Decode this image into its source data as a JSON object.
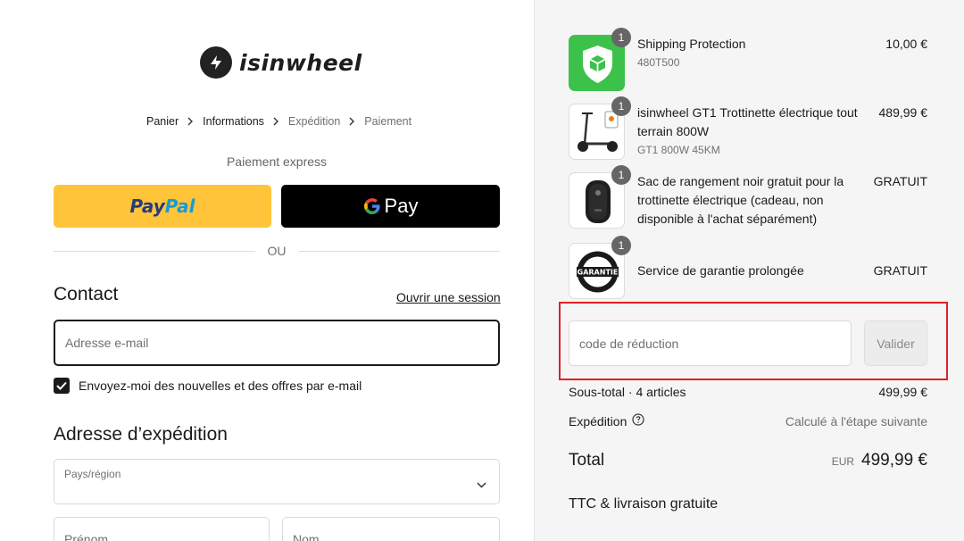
{
  "brand": {
    "name": "isinwheel"
  },
  "breadcrumb": [
    "Panier",
    "Informations",
    "Expédition",
    "Paiement"
  ],
  "express": {
    "label": "Paiement express",
    "paypal_pay": "Pay",
    "paypal_pal": "Pal",
    "gpay_label": "Pay"
  },
  "divider_text": "OU",
  "contact": {
    "title": "Contact",
    "login_link": "Ouvrir une session",
    "email_placeholder": "Adresse e-mail",
    "newsletter_label": "Envoyez-moi des nouvelles et des offres par e-mail",
    "newsletter_checked": true
  },
  "shipping": {
    "title": "Adresse d’expédition",
    "country_label": "Pays/région",
    "first_name_placeholder": "Prénom",
    "last_name_placeholder": "Nom"
  },
  "summary": {
    "items": [
      {
        "name": "Shipping Protection",
        "variant": "480T500",
        "price": "10,00 €",
        "qty": "1",
        "icon": "shield-box-icon"
      },
      {
        "name": "isinwheel GT1 Trottinette électrique tout terrain 800W",
        "variant": "GT1 800W 45KM",
        "price": "489,99 €",
        "qty": "1",
        "icon": "scooter-icon"
      },
      {
        "name": "Sac de rangement noir gratuit pour la trottinette électrique (cadeau, non disponible à l'achat séparément)",
        "variant": "",
        "price": "GRATUIT",
        "qty": "1",
        "icon": "bag-icon"
      },
      {
        "name": "Service de garantie prolongée",
        "variant": "",
        "price": "GRATUIT",
        "qty": "1",
        "icon": "warranty-badge-icon"
      }
    ],
    "discount_placeholder": "code de réduction",
    "apply_label": "Valider",
    "subtotal_label": "Sous-total · 4 articles",
    "subtotal_value": "499,99 €",
    "shipping_label": "Expédition",
    "shipping_value": "Calculé à l'étape suivante",
    "total_label": "Total",
    "total_currency": "EUR",
    "total_value": "499,99 €",
    "tax_note": "TTC & livraison gratuite"
  },
  "colors": {
    "paypal_yellow": "#ffc439",
    "paypal_dark_blue": "#253b80",
    "paypal_light_blue": "#179bd7",
    "highlight_red": "#e0202a",
    "protection_green": "#3cc24a"
  }
}
